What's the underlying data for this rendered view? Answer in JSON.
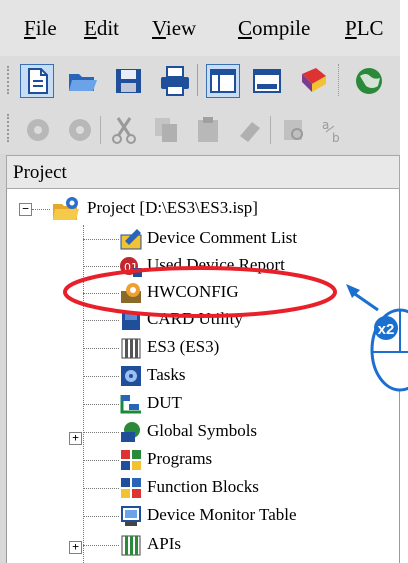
{
  "menu": {
    "file": {
      "u": "F",
      "rest": "ile"
    },
    "edit": {
      "u": "E",
      "rest": "dit"
    },
    "view": {
      "u": "V",
      "rest": "iew"
    },
    "compile": {
      "u": "C",
      "rest": "ompile"
    },
    "plc": {
      "u": "P",
      "rest": "LC"
    }
  },
  "panel": {
    "title": "Project"
  },
  "tree": {
    "root_label": "Project [D:\\ES3\\ES3.isp]",
    "items": [
      "Device Comment List",
      "Used Device Report",
      "HWCONFIG",
      "CARD Utility",
      "ES3  (ES3)",
      "Tasks",
      "DUT",
      "Global Symbols",
      "Programs",
      "Function Blocks",
      "Device Monitor Table",
      "APIs"
    ]
  },
  "callout": {
    "label": "x2",
    "highlight_target": "HWCONFIG",
    "color": "#1a6fd0"
  },
  "colors": {
    "highlight_ring": "#e8202a",
    "accent_blue": "#1a6fd0"
  }
}
